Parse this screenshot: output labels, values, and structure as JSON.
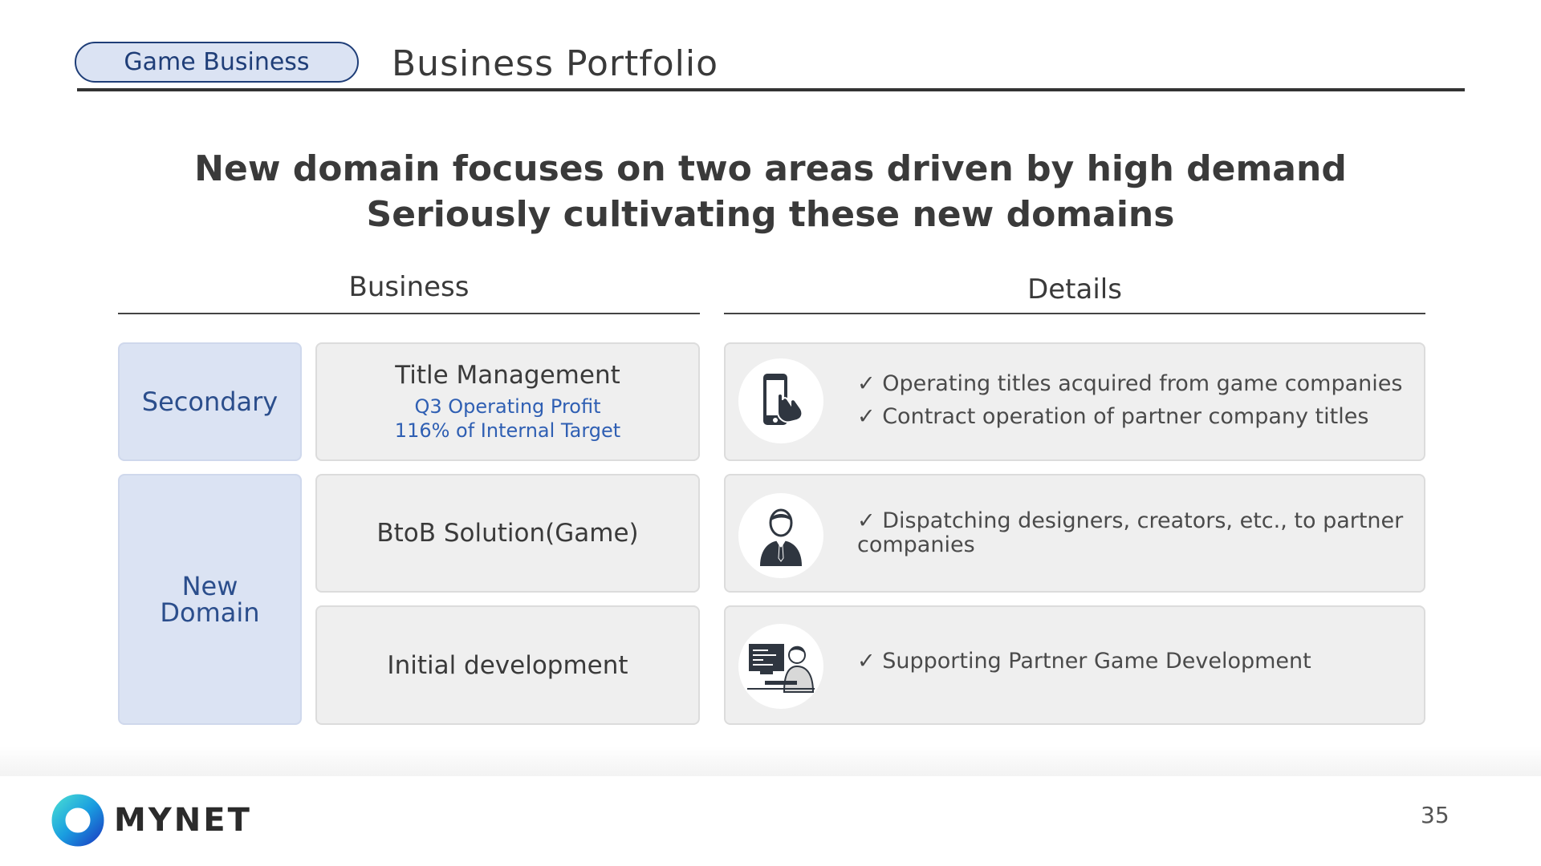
{
  "header": {
    "tag": "Game Business",
    "title": "Business Portfolio"
  },
  "headline": {
    "line1": "New domain focuses on two areas driven by high demand",
    "line2": "Seriously cultivating these new domains"
  },
  "columns": {
    "business": "Business",
    "details": "Details"
  },
  "categories": {
    "secondary": "Secondary",
    "new_domain_line1": "New",
    "new_domain_line2": "Domain"
  },
  "rows": [
    {
      "business": "Title Management",
      "sub_line1": "Q3 Operating Profit",
      "sub_line2": "116% of Internal Target",
      "icon": "smartphone-touch-icon",
      "details": [
        "✓ Operating titles acquired from game companies",
        "✓ Contract operation of partner company titles"
      ]
    },
    {
      "business": "BtoB Solution(Game)",
      "icon": "business-person-icon",
      "details": [
        "✓ Dispatching designers, creators, etc., to partner companies"
      ]
    },
    {
      "business": "Initial development",
      "icon": "developer-at-computer-icon",
      "details": [
        "✓ Supporting Partner Game Development"
      ]
    }
  ],
  "footer": {
    "brand": "MYNET",
    "page_number": "35"
  },
  "colors": {
    "accent_navy": "#1f3e78",
    "label_blue": "#2b4e8c",
    "highlight_blue": "#2f5fb3",
    "pill_fill": "#dbe3f3",
    "cell_gray": "#efefef"
  }
}
